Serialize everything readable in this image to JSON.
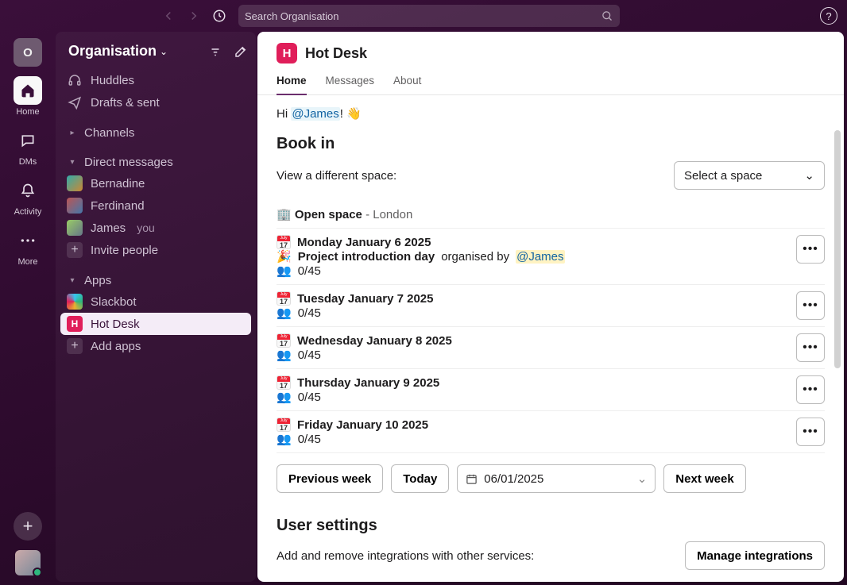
{
  "topbar": {
    "search_placeholder": "Search Organisation"
  },
  "rail": {
    "org_initial": "O",
    "items": [
      {
        "label": "Home"
      },
      {
        "label": "DMs"
      },
      {
        "label": "Activity"
      },
      {
        "label": "More"
      }
    ]
  },
  "sidebar": {
    "title": "Organisation",
    "huddles": "Huddles",
    "drafts": "Drafts & sent",
    "sections": {
      "channels": "Channels",
      "direct_messages": "Direct messages",
      "apps": "Apps"
    },
    "dms": [
      {
        "name": "Bernadine",
        "color1": "#3aa",
        "color2": "#c83"
      },
      {
        "name": "Ferdinand",
        "color1": "#b55",
        "color2": "#47a"
      },
      {
        "name": "James",
        "you_label": "you",
        "is_self": true,
        "color1": "#9c6",
        "color2": "#678"
      }
    ],
    "invite_people": "Invite people",
    "apps": [
      {
        "name": "Slackbot",
        "icon_gradient": true
      },
      {
        "name": "Hot Desk",
        "icon_letter": "H",
        "icon_bg": "#e01e5a",
        "selected": true
      }
    ],
    "add_apps": "Add apps"
  },
  "content": {
    "app_name": "Hot Desk",
    "app_icon_letter": "H",
    "tabs": [
      {
        "label": "Home",
        "active": true
      },
      {
        "label": "Messages"
      },
      {
        "label": "About"
      }
    ],
    "greeting_prefix": "Hi ",
    "greeting_mention": "@James",
    "greeting_suffix": "! 👋",
    "bookin_heading": "Book in",
    "view_space_label": "View a different space:",
    "select_space_placeholder": "Select a space",
    "space": {
      "emoji": "🏢",
      "name": "Open space",
      "location": " - London"
    },
    "days": [
      {
        "date": "Monday January 6 2025",
        "event": {
          "emoji": "🎉",
          "name": "Project introduction day",
          "organised_by_label": " organised by ",
          "organiser": "@James"
        },
        "count": "0/45"
      },
      {
        "date": "Tuesday January 7 2025",
        "count": "0/45"
      },
      {
        "date": "Wednesday January 8 2025",
        "count": "0/45"
      },
      {
        "date": "Thursday January 9 2025",
        "count": "0/45"
      },
      {
        "date": "Friday January 10 2025",
        "count": "0/45"
      }
    ],
    "prev_week": "Previous week",
    "today": "Today",
    "date_value": "06/01/2025",
    "next_week": "Next week",
    "user_settings_heading": "User settings",
    "integrations_text": "Add and remove integrations with other services:",
    "manage_integrations": "Manage integrations"
  }
}
